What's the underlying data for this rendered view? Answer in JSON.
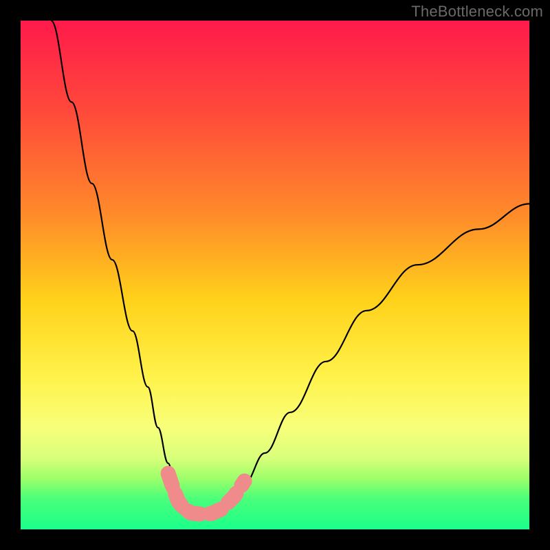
{
  "watermark": "TheBottleneck.com",
  "chart_data": {
    "type": "line",
    "title": "",
    "xlabel": "",
    "ylabel": "",
    "xlim": [
      0,
      100
    ],
    "ylim": [
      0,
      100
    ],
    "grid": false,
    "legend": false,
    "annotations": [],
    "background_gradient": {
      "stops": [
        {
          "pct": 0,
          "color": "#ff1a4b"
        },
        {
          "pct": 18,
          "color": "#ff4a3a"
        },
        {
          "pct": 38,
          "color": "#ff8a2a"
        },
        {
          "pct": 55,
          "color": "#ffd21a"
        },
        {
          "pct": 70,
          "color": "#fff24a"
        },
        {
          "pct": 80,
          "color": "#f8ff7a"
        },
        {
          "pct": 86,
          "color": "#d8ff7a"
        },
        {
          "pct": 90,
          "color": "#9dff6a"
        },
        {
          "pct": 94,
          "color": "#4aff7a"
        },
        {
          "pct": 100,
          "color": "#1aff8a"
        }
      ]
    },
    "series": [
      {
        "name": "bottleneck-curve",
        "stroke": "#000000",
        "x": [
          6,
          10,
          14,
          18,
          22,
          25,
          27,
          29,
          30.5,
          32,
          34,
          36,
          38,
          41,
          44,
          48,
          53,
          60,
          68,
          78,
          90,
          100
        ],
        "y": [
          100,
          84,
          68,
          53,
          39,
          28,
          20,
          13,
          8,
          4.5,
          3,
          3,
          3.2,
          5,
          9,
          15,
          23,
          33,
          43,
          52,
          59,
          64
        ]
      }
    ],
    "markers": [
      {
        "name": "marker-cluster",
        "shape": "rounded-dot",
        "color": "#ef8b8b",
        "points": [
          {
            "x": 29.0,
            "y": 11.0
          },
          {
            "x": 30.0,
            "y": 8.0
          },
          {
            "x": 31.0,
            "y": 5.5
          },
          {
            "x": 32.0,
            "y": 4.2
          },
          {
            "x": 33.5,
            "y": 3.2
          },
          {
            "x": 35.5,
            "y": 3.0
          },
          {
            "x": 37.5,
            "y": 3.1
          },
          {
            "x": 39.5,
            "y": 4.0
          },
          {
            "x": 42.0,
            "y": 6.5
          },
          {
            "x": 44.0,
            "y": 9.5
          }
        ]
      }
    ]
  }
}
